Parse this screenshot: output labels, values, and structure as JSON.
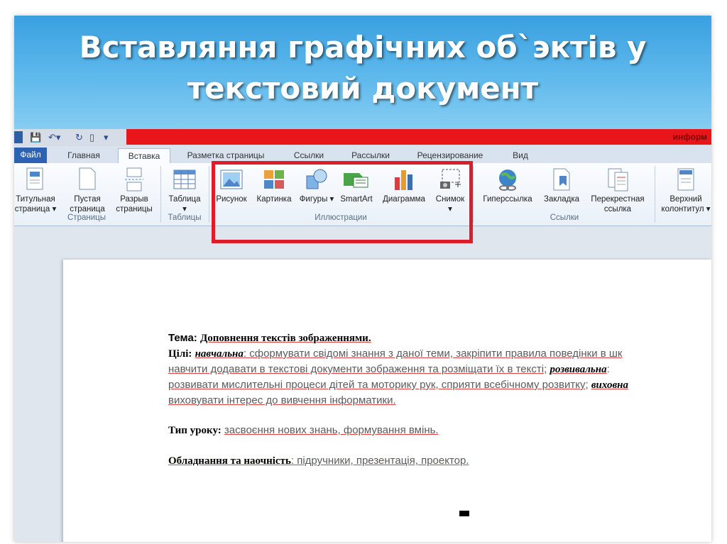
{
  "slide": {
    "title_line1": "Вставляння графічних об`эктів у",
    "title_line2": "текстовий документ"
  },
  "window": {
    "doc_title": "информ"
  },
  "tabs": [
    {
      "label": "Файл"
    },
    {
      "label": "Главная"
    },
    {
      "label": "Вставка",
      "active": true
    },
    {
      "label": "Разметка страницы"
    },
    {
      "label": "Ссылки"
    },
    {
      "label": "Рассылки"
    },
    {
      "label": "Рецензирование"
    },
    {
      "label": "Вид"
    }
  ],
  "ribbon": {
    "pages": {
      "group": "Страницы",
      "cover": {
        "line1": "Титульная",
        "line2": "страница ▾"
      },
      "blank": {
        "line1": "Пустая",
        "line2": "страница"
      },
      "break": {
        "line1": "Разрыв",
        "line2": "страницы"
      }
    },
    "tables": {
      "group": "Таблицы",
      "table": {
        "line1": "Таблица",
        "line2": "▾"
      }
    },
    "illustrations": {
      "group": "Иллюстрации",
      "picture": "Рисунок",
      "clipart": "Картинка",
      "shapes": "Фигуры ▾",
      "smartart": "SmartArt",
      "chart": "Диаграмма",
      "screenshot": {
        "line1": "Снимок",
        "line2": "▾"
      }
    },
    "links": {
      "group": "Ссылки",
      "hyperlink": "Гиперссылка",
      "bookmark": "Закладка",
      "crossref": {
        "line1": "Перекрестная",
        "line2": "ссылка"
      }
    },
    "header": {
      "line1": "Верхний",
      "line2": "колонтитул ▾"
    }
  },
  "document": {
    "topic_label": "Тема:",
    "topic_value": "Доповнення текстів зображеннями.",
    "goals_label": "Цілі:",
    "goals_k1": "навчальна",
    "goals_t1": ": сформувати свідомі знання з даної теми, закріпити правила поведінки в шк",
    "goals_t2": "навчити додавати в текстові документи зображення та розміщати їх в тексті;",
    "goals_k2": "розвивальна",
    "goals_t2b": ":",
    "goals_t3": "розвивати мислительні процеси дітей та моторику рук, сприяти всебічному розвитку;",
    "goals_k3": "виховна",
    "goals_t4": "виховувати інтерес до вивчення інформатики.",
    "type_label": "Тип уроку:",
    "type_value": "засвоєння нових знань, формування вмінь.",
    "equip_label": "Обладнання та наочність",
    "equip_value": ": підручники, презентація, проектор."
  }
}
